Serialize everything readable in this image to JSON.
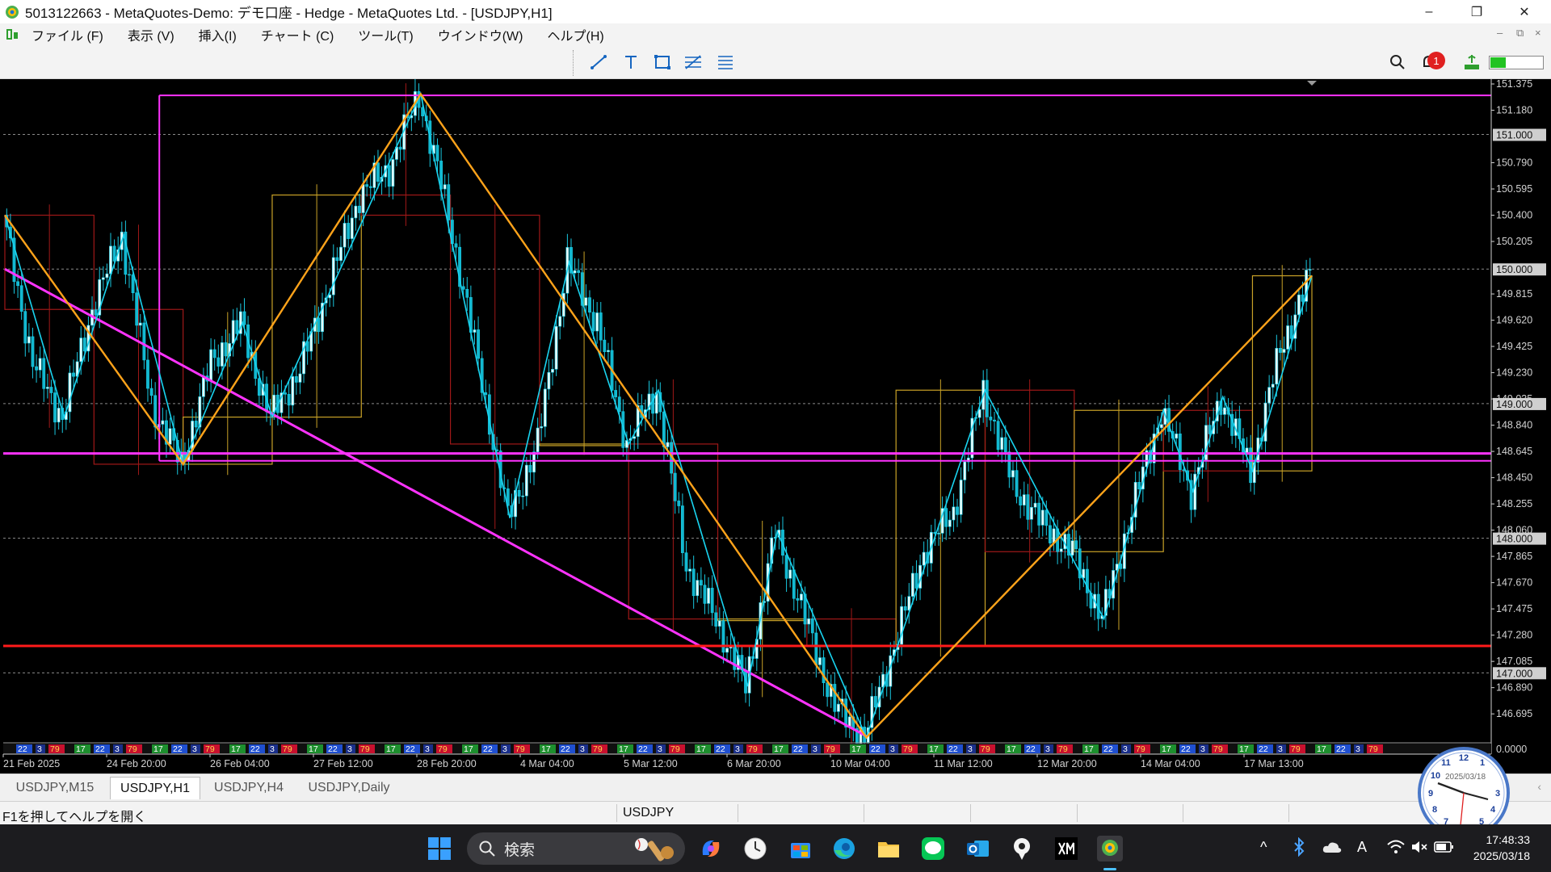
{
  "window": {
    "title": "5013122663 - MetaQuotes-Demo: デモ口座 - Hedge - MetaQuotes Ltd. - [USDJPY,H1]",
    "controls": {
      "minimize": "–",
      "restore": "❐",
      "close": "✕"
    }
  },
  "menu": [
    "ファイル (F)",
    "表示 (V)",
    "挿入(I)",
    "チャート (C)",
    "ツール(T)",
    "ウインドウ(W)",
    "ヘルプ(H)"
  ],
  "mdi_controls": {
    "minimize": "–",
    "restore": "⧉",
    "close": "×"
  },
  "toolbar": {
    "tools": [
      "trendline-tool",
      "text-tool",
      "rectangle-tool",
      "fibonacci-tool",
      "channel-tool"
    ],
    "notification_count": "1",
    "signal_level": 0.3
  },
  "chart_data": {
    "type": "line",
    "symbol": "USDJPY",
    "timeframe": "H1",
    "ylim": [
      146.6,
      151.41
    ],
    "grid": true,
    "y_ticks": [
      "151.375",
      "151.180",
      "150.790",
      "150.595",
      "150.400",
      "150.205",
      "149.815",
      "149.620",
      "149.425",
      "149.230",
      "149.035",
      "148.840",
      "148.645",
      "148.450",
      "148.255",
      "148.060",
      "147.865",
      "147.670",
      "147.475",
      "147.280",
      "147.085",
      "146.890",
      "146.695"
    ],
    "y_levels_highlighted": [
      "151.000",
      "150.000",
      "149.000",
      "148.000",
      "147.000"
    ],
    "indicator_value": "0.0000",
    "x_tick_labels": [
      "21 Feb 2025",
      "24 Feb 20:00",
      "26 Feb 04:00",
      "27 Feb 12:00",
      "28 Feb 20:00",
      "4 Mar 04:00",
      "5 Mar 12:00",
      "6 Mar 20:00",
      "10 Mar 04:00",
      "11 Mar 12:00",
      "12 Mar 20:00",
      "14 Mar 04:00",
      "17 Mar 13:00"
    ],
    "close_path": [
      150.4,
      149.3,
      148.9,
      149.7,
      150.25,
      149.0,
      148.55,
      149.3,
      149.6,
      148.9,
      149.25,
      149.9,
      150.55,
      150.75,
      151.3,
      150.4,
      149.3,
      148.15,
      148.7,
      150.05,
      149.6,
      148.7,
      149.1,
      147.8,
      147.4,
      146.9,
      148.05,
      147.4,
      146.75,
      146.52,
      147.2,
      147.9,
      148.2,
      149.1,
      148.4,
      148.1,
      147.9,
      147.4,
      148.2,
      148.95,
      148.35,
      149.05,
      148.5,
      149.4,
      149.95
    ],
    "horizontal_lines": {
      "resistance_top": 151.29,
      "support_upper": 148.63,
      "support_lower": 148.575,
      "red_level": 147.2
    },
    "trendline": {
      "start_price": 150.0,
      "end_price": 146.53
    },
    "session_labels": [
      "17",
      "22",
      "3",
      "79"
    ]
  },
  "tabs": [
    "USDJPY,M15",
    "USDJPY,H1",
    "USDJPY,H4",
    "USDJPY,Daily"
  ],
  "active_tab": "USDJPY,H1",
  "status": {
    "help": "F1を押してヘルプを開く",
    "symbol": "USDJPY"
  },
  "clock": {
    "date": "2025/03/18",
    "numbers": [
      "12",
      "1",
      "3",
      "4",
      "5",
      "7",
      "8",
      "9",
      "10",
      "11"
    ]
  },
  "taskbar": {
    "search_placeholder": "検索",
    "apps": [
      "windows-start-icon",
      "baseball-icon",
      "copilot-icon",
      "clock-app-icon",
      "store-icon",
      "edge-icon",
      "file-explorer-icon",
      "line-icon",
      "outlook-icon",
      "pin-app-icon",
      "xm-icon",
      "metatrader-icon"
    ],
    "time": "17:48:33",
    "date": "2025/03/18",
    "tray_ime": "A"
  },
  "colors": {
    "magenta": "#ff33ff",
    "orange": "#ffa31a",
    "cyan": "#19d4f0",
    "red": "#ff1a1a",
    "box_up": "#c9a227",
    "box_down": "#a01818"
  }
}
